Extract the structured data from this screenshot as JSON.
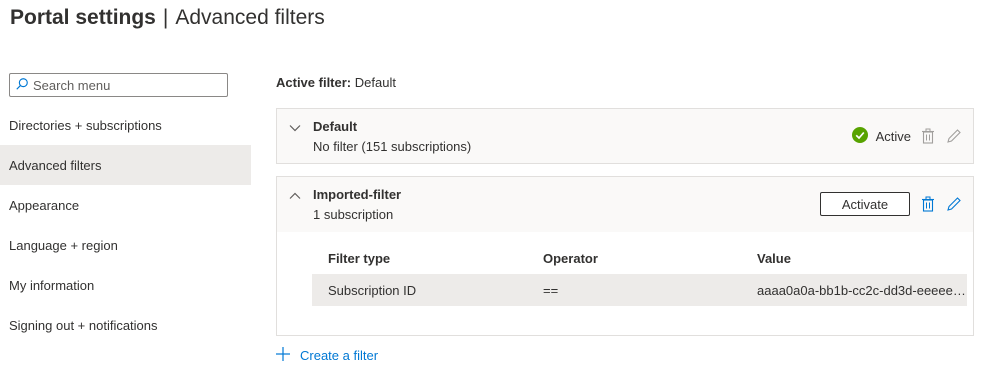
{
  "header": {
    "title": "Portal settings",
    "separator": "|",
    "subtitle": "Advanced filters"
  },
  "search": {
    "placeholder": "Search menu",
    "value": ""
  },
  "menu": {
    "items": [
      {
        "label": "Directories + subscriptions"
      },
      {
        "label": "Advanced filters",
        "selected": true
      },
      {
        "label": "Appearance"
      },
      {
        "label": "Language + region"
      },
      {
        "label": "My information"
      },
      {
        "label": "Signing out + notifications"
      }
    ]
  },
  "active_filter": {
    "label": "Active filter:",
    "value": "Default"
  },
  "filters": [
    {
      "name": "Default",
      "description": "No filter (151 subscriptions)",
      "expanded": false,
      "status": "Active",
      "status_color": "#57a300"
    },
    {
      "name": "Imported-filter",
      "description": "1 subscription",
      "expanded": true,
      "action_label": "Activate",
      "table": {
        "headers": [
          "Filter type",
          "Operator",
          "Value"
        ],
        "rows": [
          [
            "Subscription ID",
            "==",
            "aaaa0a0a-bb1b-cc2c-dd3d-eeeeee4e4e4e"
          ]
        ]
      }
    }
  ],
  "create_filter": {
    "label": "Create a filter"
  },
  "colors": {
    "accent": "#0078d4",
    "success": "#57a300",
    "selected_bg": "#edebe9",
    "disabled_icon": "#a19f9d"
  },
  "icons": {
    "search": "search-icon",
    "chevron_down": "chevron-down-icon",
    "chevron_up": "chevron-up-icon",
    "check": "check-circle-icon",
    "delete": "trash-icon",
    "edit": "pencil-icon",
    "add": "plus-icon"
  }
}
